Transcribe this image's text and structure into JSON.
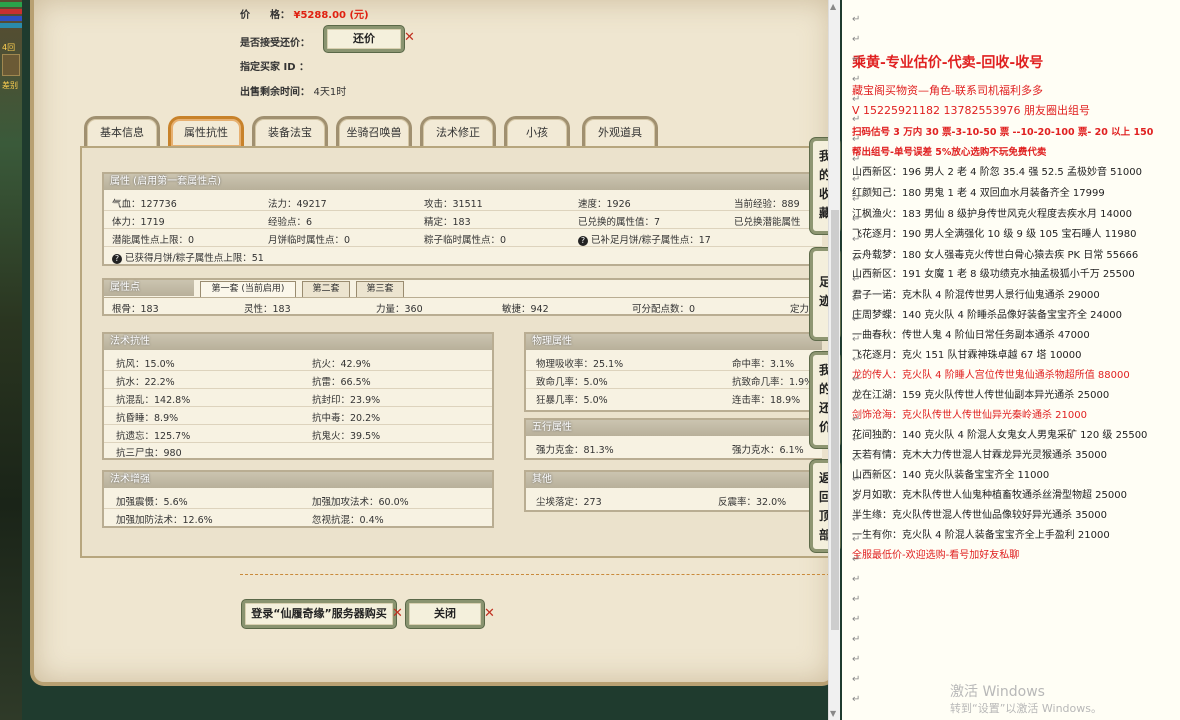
{
  "listing": {
    "price_label": "价　　格：",
    "price_value": "¥5288.00 (元)",
    "bargain_label": "是否接受还价：",
    "bargain_button": "还价",
    "buyer_label": "指定买家 ID ：",
    "time_label": "出售剩余时间：",
    "time_value": "4天1时"
  },
  "tabs": [
    "基本信息",
    "属性抗性",
    "装备法宝",
    "坐骑召唤兽",
    "法术修正",
    "小孩",
    "外观道具"
  ],
  "attributes": {
    "header": "属性 (启用第一套属性点)",
    "rows": [
      [
        "气血：127736",
        "法力：49217",
        "攻击：31511",
        "速度：1926",
        "当前经验：889"
      ],
      [
        "体力：1719",
        "经验点：6",
        "精定：183",
        "已兑换的属性值：7",
        "已兑换潜能属性"
      ],
      [
        "潜能属性点上限：0",
        "月饼临时属性点：0",
        "粽子临时属性点：0",
        "已补足月饼/粽子属性点：17",
        ""
      ]
    ],
    "extra": "已获得月饼/粽子属性点上限：51"
  },
  "points": {
    "header": "属性点",
    "subtabs": [
      "第一套 (当前启用)",
      "第二套",
      "第三套"
    ],
    "row": [
      "根骨：183",
      "灵性：183",
      "力量：360",
      "敏捷：942",
      "可分配点数：0",
      "定力"
    ]
  },
  "resist": {
    "header": "法术抗性",
    "left": [
      "抗风：15.0%",
      "抗水：22.2%",
      "抗混乱：142.8%",
      "抗昏睡：8.9%",
      "抗遗忘：125.7%",
      "抗三尸虫：980"
    ],
    "right": [
      "抗火：42.9%",
      "抗雷：66.5%",
      "抗封印：23.9%",
      "抗中毒：20.2%",
      "抗鬼火：39.5%"
    ]
  },
  "physical": {
    "header": "物理属性",
    "left": [
      "物理吸收率：25.1%",
      "致命几率：5.0%",
      "狂暴几率：5.0%"
    ],
    "right": [
      "命中率：3.1%",
      "抗致命几率：1.9%",
      "连击率：18.9%"
    ]
  },
  "enhance": {
    "header": "法术增强",
    "left": [
      "加强震慑：5.6%",
      "加强加防法术：12.6%"
    ],
    "right": [
      "加强加攻法术：60.0%",
      "忽视抗混：0.4%"
    ]
  },
  "elements": {
    "header": "五行属性",
    "left": "强力克金：81.3%",
    "right": "强力克水：6.1%"
  },
  "other": {
    "header": "其他",
    "left": "尘埃落定：273",
    "right": "反震率：32.0%"
  },
  "side_nav": [
    "我的收藏",
    "足迹",
    "我的还价",
    "返回顶部"
  ],
  "bottom_buttons": {
    "buy": "登录“仙履奇缘”服务器购买",
    "close": "关闭"
  },
  "gamestrip": {
    "label1": "4回",
    "label2": "差别"
  },
  "doc": {
    "lines": [
      {
        "text": "乘黄-专业估价-代卖-回收-收号",
        "style": "title"
      },
      {
        "text": "藏宝阁买物资—角色-联系司机福利多多",
        "style": "subred"
      },
      {
        "text": "V 15225921182    13782553976 朋友圈出组号",
        "style": "subred"
      },
      {
        "text": "扫码估号 3 万内 30 票-3-10-50 票  --10-20-100 票- 20 以上 150",
        "style": "boldred"
      },
      {
        "text": "帮出组号-单号误差 5%放心选购不玩免费代卖",
        "style": "boldred"
      },
      {
        "text": "山西新区：196 男人 2 老 4 阶忽 35.4 强 52.5 孟极妙音 51000",
        "style": "normal"
      },
      {
        "text": "红颜知己：180 男鬼 1 老 4 双回血水月装备齐全 17999",
        "style": "normal"
      },
      {
        "text": "江枫渔火：183 男仙 8 级护身传世风克火程度去疾水月 14000",
        "style": "normal"
      },
      {
        "text": "飞花逐月：190 男人全满强化 10 级 9 级 105 宝石睡人 11980",
        "style": "normal"
      },
      {
        "text": "云舟载梦：180 女人强毒克火传世白骨心猿去疾 PK 日常 55666",
        "style": "normal"
      },
      {
        "text": "山西新区：191 女魔 1 老 8 级功绩克水抽孟极狐小千万 25500",
        "style": "normal"
      },
      {
        "text": "君子一诺：克木队 4 阶混传世男人景行仙鬼通杀 29000",
        "style": "normal"
      },
      {
        "text": "庄周梦蝶：140 克火队 4 阶睡杀品像好装备宝宝齐全 24000",
        "style": "normal"
      },
      {
        "text": "一曲春秋：传世人鬼 4 阶仙日常任务副本通杀 47000",
        "style": "normal"
      },
      {
        "text": "飞花逐月：克火 151 队甘霖神珠卓越 67 塔 10000",
        "style": "normal"
      },
      {
        "text": "龙的传人：克火队 4 阶睡人宫位传世鬼仙通杀物超所值 88000",
        "style": "red"
      },
      {
        "text": "龙在江湖：159 克火队传世人传世仙副本异光通杀 25000",
        "style": "normal"
      },
      {
        "text": "剑饰沧海：克火队传世人传世仙异光秦岭通杀 21000",
        "style": "red"
      },
      {
        "text": "花间独酌：140 克火队 4 阶混人女鬼女人男鬼采矿 120 级 25500",
        "style": "normal"
      },
      {
        "text": "天若有情：克木大力传世混人甘霖龙异光灵猴通杀 35000",
        "style": "normal"
      },
      {
        "text": "山西新区：140 克火队装备宝宝齐全 11000",
        "style": "normal"
      },
      {
        "text": "岁月如歌：克木队传世人仙鬼种植畜牧通杀丝滑型物超 25000",
        "style": "normal"
      },
      {
        "text": "半生缘：克火队传世混人传世仙品像较好异光通杀 35000",
        "style": "normal"
      },
      {
        "text": "一生有你：克火队 4 阶混人装备宝宝齐全上手盈利 21000",
        "style": "normal"
      },
      {
        "text": "全服最低价-欢迎选购-看号加好友私聊",
        "style": "red"
      }
    ],
    "watermark_title": "激活 Windows",
    "watermark_sub": "转到“设置”以激活 Windows。"
  },
  "colors": {
    "accent_red": "#e02020",
    "panel_bg": "#efe6d0",
    "tab_active_border": "#c8822a"
  }
}
